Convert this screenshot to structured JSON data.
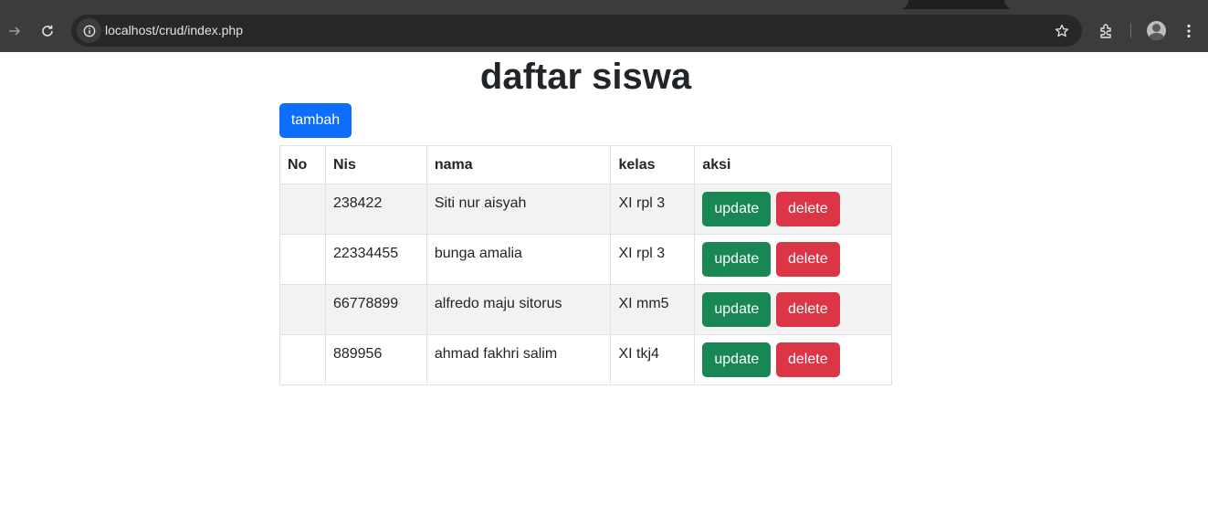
{
  "browser": {
    "url": "localhost/crud/index.php",
    "icons": [
      "forward-icon",
      "reload-icon",
      "site-info-icon",
      "bookmark-star-icon",
      "extensions-icon",
      "profile-avatar",
      "menu-icon"
    ]
  },
  "page": {
    "title": "daftar siswa",
    "add_button_label": "tambah"
  },
  "table": {
    "headers": [
      "No",
      "Nis",
      "nama",
      "kelas",
      "aksi"
    ],
    "rows": [
      {
        "no": "",
        "nis": "238422",
        "nama": "Siti nur aisyah",
        "kelas": "XI rpl 3",
        "update": "update",
        "delete": "delete"
      },
      {
        "no": "",
        "nis": "22334455",
        "nama": "bunga amalia",
        "kelas": "XI rpl 3",
        "update": "update",
        "delete": "delete"
      },
      {
        "no": "",
        "nis": "66778899",
        "nama": "alfredo maju sitorus",
        "kelas": "XI mm5",
        "update": "update",
        "delete": "delete"
      },
      {
        "no": "",
        "nis": "889956",
        "nama": "ahmad fakhri salim",
        "kelas": "XI tkj4",
        "update": "update",
        "delete": "delete"
      }
    ]
  },
  "colors": {
    "primary": "#0d6efd",
    "success": "#198754",
    "danger": "#dc3545",
    "stripe": "#f2f2f2",
    "chrome": "#3c3c3c"
  }
}
